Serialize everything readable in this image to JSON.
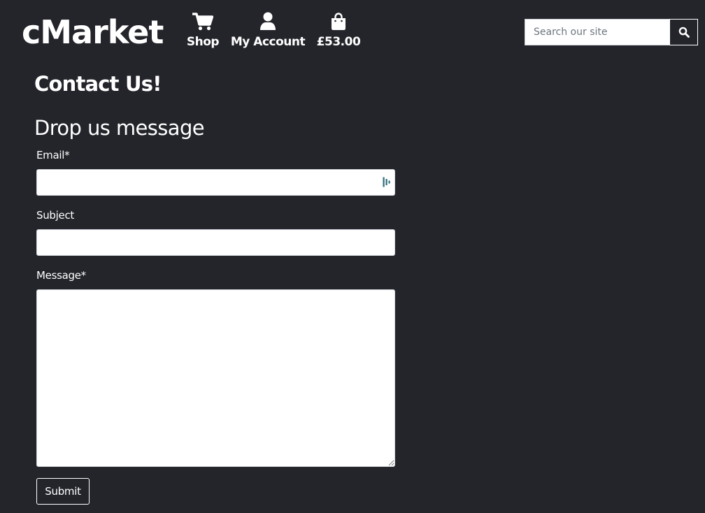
{
  "header": {
    "logo_text": "cMarket",
    "nav": {
      "shop": {
        "label": "Shop",
        "icon": "shopping-cart-icon"
      },
      "account": {
        "label": "My Account",
        "icon": "user-icon"
      },
      "basket": {
        "label": "£53.00",
        "icon": "shopping-bag-icon"
      }
    },
    "search": {
      "placeholder": "Search our site",
      "value": "",
      "button_icon": "search-icon"
    }
  },
  "main": {
    "page_title": "Contact Us!",
    "form": {
      "heading": "Drop us message",
      "email": {
        "label": "Email*",
        "value": ""
      },
      "subject": {
        "label": "Subject",
        "value": ""
      },
      "message": {
        "label": "Message*",
        "value": ""
      },
      "submit_label": "Submit"
    }
  },
  "colors": {
    "background": "#24252b",
    "text": "#ffffff",
    "input_background": "#ffffff",
    "autofill_icon": "#2c6b7a"
  }
}
